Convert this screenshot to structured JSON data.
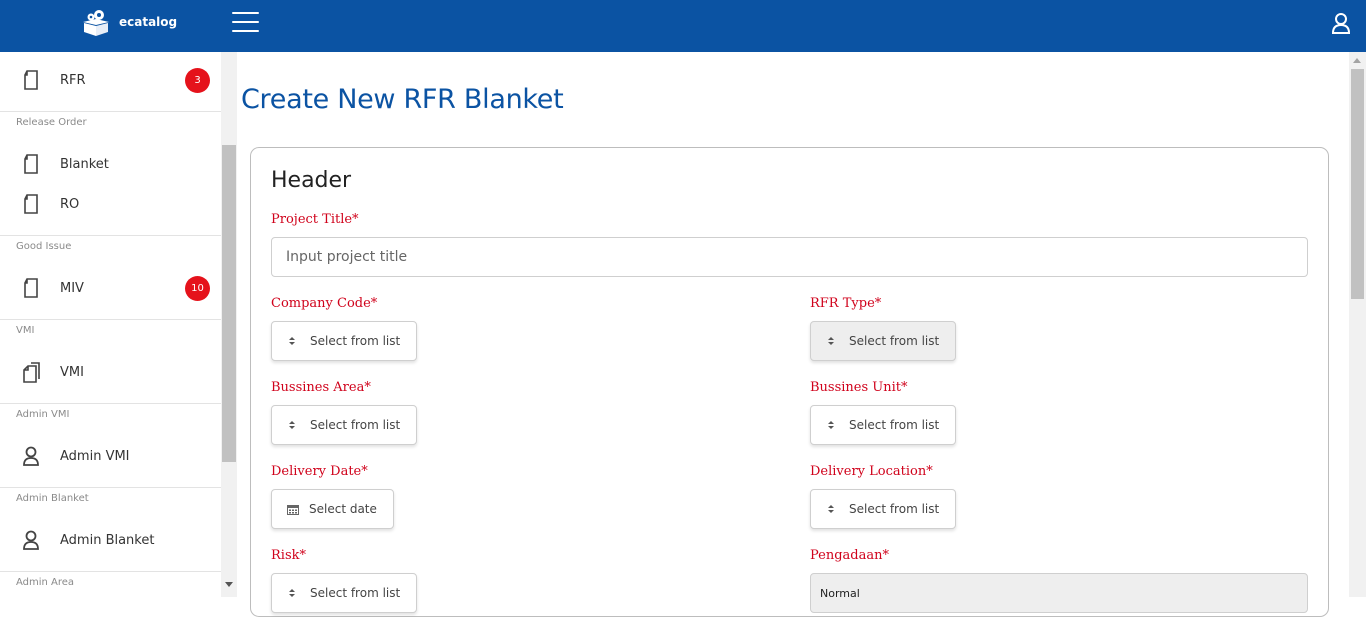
{
  "app": {
    "name": "ecatalog",
    "brand_color": "#0b53a3",
    "accent_red": "#d0021b",
    "badge_red": "#e5121b"
  },
  "topbar": {
    "menu_icon": "hamburger-icon",
    "user_icon": "user-icon"
  },
  "sidebar": {
    "items": [
      {
        "label": "RFR",
        "icon": "document-icon",
        "badge": "3"
      },
      {
        "label": "Blanket",
        "icon": "document-icon"
      },
      {
        "label": "RO",
        "icon": "document-icon"
      },
      {
        "label": "MIV",
        "icon": "document-icon",
        "badge": "10"
      },
      {
        "label": "VMI",
        "icon": "documents-icon"
      },
      {
        "label": "Admin VMI",
        "icon": "person-icon"
      },
      {
        "label": "Admin Blanket",
        "icon": "person-icon"
      }
    ],
    "sections": [
      "Release Order",
      "Good Issue",
      "VMI",
      "Admin VMI",
      "Admin Blanket",
      "Admin Area"
    ]
  },
  "page": {
    "title": "Create New RFR Blanket"
  },
  "form": {
    "card_title": "Header",
    "project_title": {
      "label": "Project Title*",
      "placeholder": "Input project title",
      "value": ""
    },
    "company_code": {
      "label": "Company Code*",
      "value": "Select from list"
    },
    "rfr_type": {
      "label": "RFR Type*",
      "value": "Select from list"
    },
    "bussines_area": {
      "label": "Bussines Area*",
      "value": "Select from list"
    },
    "bussines_unit": {
      "label": "Bussines Unit*",
      "value": "Select from list"
    },
    "delivery_date": {
      "label": "Delivery Date*",
      "value": "Select date"
    },
    "delivery_location": {
      "label": "Delivery Location*",
      "value": "Select from list"
    },
    "risk": {
      "label": "Risk*",
      "value": "Select from list"
    },
    "pengadaan": {
      "label": "Pengadaan*",
      "value": "Normal"
    }
  }
}
